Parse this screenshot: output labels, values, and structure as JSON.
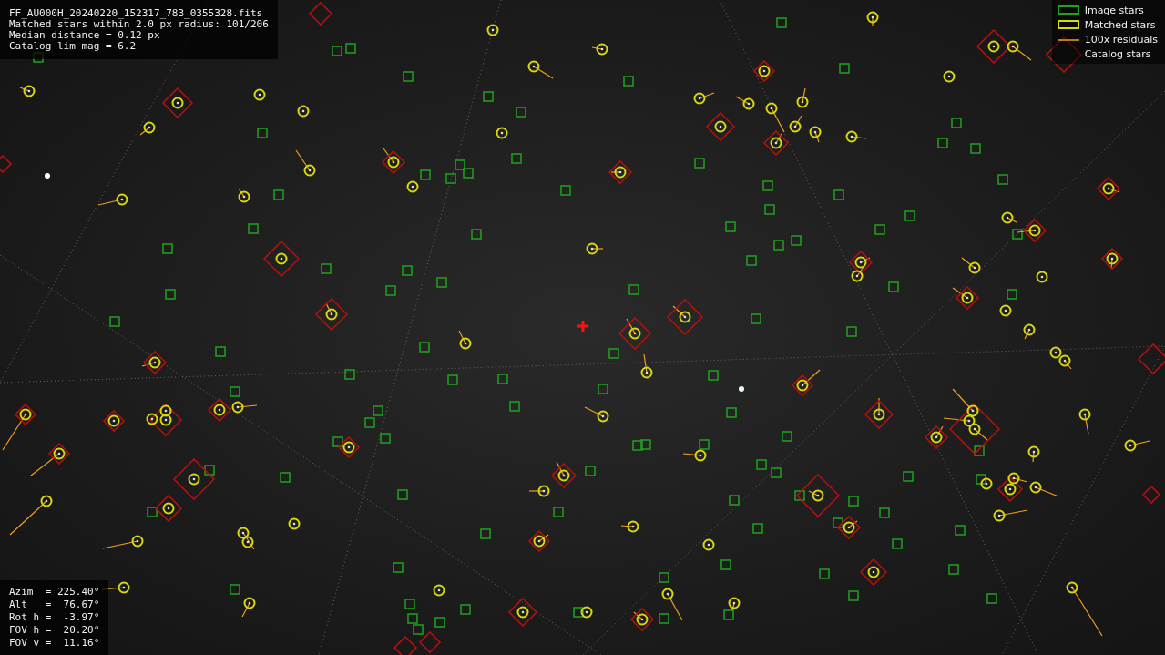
{
  "info": {
    "lines": [
      "FF_AU000H_20240220_152317_783_0355328.fits",
      "Matched stars within 2.0 px radius: 101/206",
      "Median distance = 0.12 px",
      "Catalog lim mag = 6.2"
    ]
  },
  "legend": [
    {
      "kind": "image",
      "label": "Image stars"
    },
    {
      "kind": "matched",
      "label": "Matched stars"
    },
    {
      "kind": "residual",
      "label": "100x residuals"
    },
    {
      "kind": "catalog",
      "label": "Catalog stars"
    }
  ],
  "pointing": {
    "lines": [
      "Azim  = 225.40°",
      "Alt   =  76.67°",
      "Rot h =  -3.97°",
      "FOV h =  20.20°",
      "FOV v =  11.16°"
    ]
  }
}
